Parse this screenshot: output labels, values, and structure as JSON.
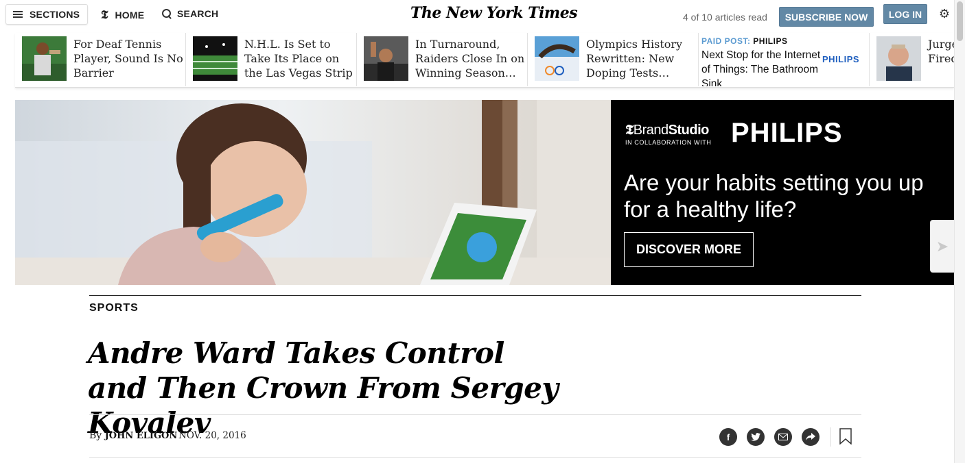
{
  "masthead": {
    "sections_label": "SECTIONS",
    "home_label": "HOME",
    "search_label": "SEARCH",
    "logo_text": "The New York Times",
    "articles_read": "4 of 10 articles read",
    "subscribe_label": "SUBSCRIBE NOW",
    "login_label": "LOG IN",
    "icons": {
      "sections": "hamburger-menu-icon",
      "home": "nyt-t-icon",
      "search": "search-icon",
      "settings": "gear-icon"
    }
  },
  "ribbon": {
    "items": [
      {
        "headline": "For Deaf Tennis Player, Sound Is No Barrier"
      },
      {
        "headline": "N.H.L. Is Set to Take Its Place on the Las Vegas Strip"
      },
      {
        "headline": "In Turnaround, Raiders Close In on Winning Season…"
      },
      {
        "headline": "Olympics History Rewritten: New Doping Tests…"
      },
      {
        "paid_label": "PAID POST:",
        "paid_brand_label": "PHILIPS",
        "headline": "Next Stop for the Internet of Things: The Bathroom Sink",
        "brand_logo": "PHILIPS"
      },
      {
        "headline": "Jurgen Klinsmann Fired as U.S. Coach"
      }
    ]
  },
  "ad": {
    "brandstudio_prefix": "Brand",
    "brandstudio_suffix": "Studio",
    "collab_text": "IN COLLABORATION WITH",
    "brand": "PHILIPS",
    "headline": "Are your habits setting you up for a healthy life?",
    "cta": "DISCOVER MORE"
  },
  "article": {
    "section": "SPORTS",
    "headline": "Andre Ward Takes Control and Then Crown From Sergey Kovalev",
    "by_prefix": "By",
    "author": "JOHN ELIGON",
    "date": "NOV. 20, 2016",
    "share_icons": [
      "facebook-icon",
      "twitter-icon",
      "email-icon",
      "share-icon",
      "bookmark-icon"
    ]
  },
  "colors": {
    "button_blue": "#6288a5",
    "paid_post_blue": "#5c9bd1",
    "philips_blue": "#1f5fbf"
  }
}
